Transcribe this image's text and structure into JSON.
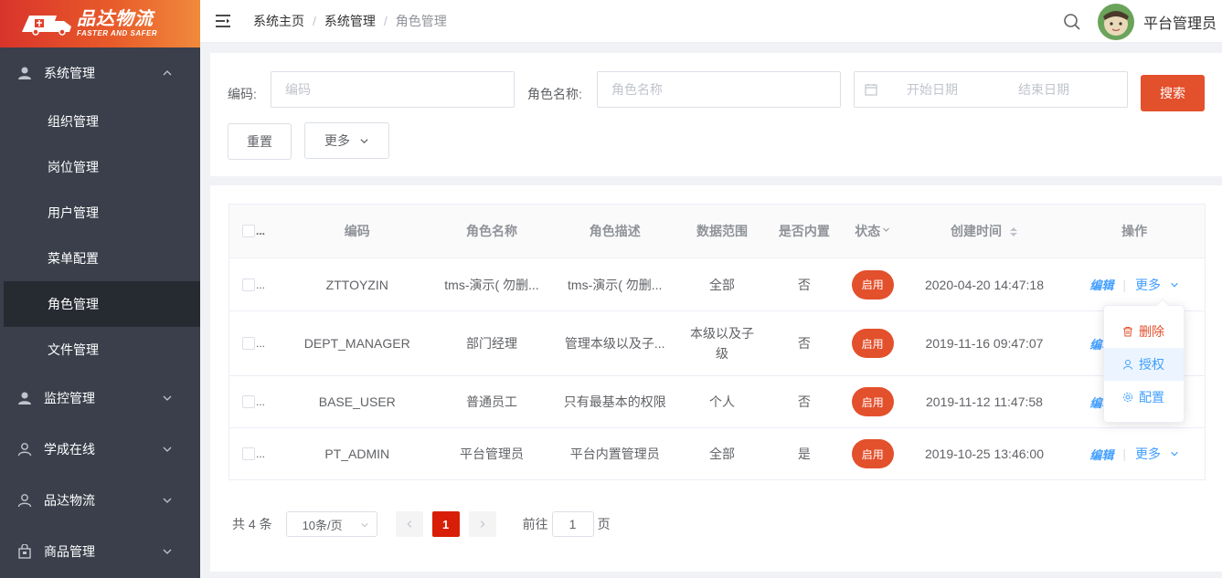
{
  "brand": {
    "name_cn": "品达物流",
    "slogan": "FASTER AND SAFER"
  },
  "sidebar": {
    "groups": [
      {
        "label": "系统管理",
        "icon": "user-icon",
        "expanded": true,
        "items": [
          {
            "label": "组织管理",
            "active": false
          },
          {
            "label": "岗位管理",
            "active": false
          },
          {
            "label": "用户管理",
            "active": false
          },
          {
            "label": "菜单配置",
            "active": false
          },
          {
            "label": "角色管理",
            "active": true
          },
          {
            "label": "文件管理",
            "active": false
          }
        ]
      },
      {
        "label": "监控管理",
        "icon": "user-icon",
        "expanded": false
      },
      {
        "label": "学成在线",
        "icon": "user-outline-icon",
        "expanded": false
      },
      {
        "label": "品达物流",
        "icon": "user-outline-icon",
        "expanded": false
      },
      {
        "label": "商品管理",
        "icon": "bag-icon",
        "expanded": false
      }
    ]
  },
  "header": {
    "breadcrumb": [
      "系统主页",
      "系统管理",
      "角色管理"
    ],
    "separator": "/",
    "username": "平台管理员"
  },
  "search": {
    "code_label": "编码:",
    "code_placeholder": "编码",
    "name_label": "角色名称:",
    "name_placeholder": "角色名称",
    "start_placeholder": "开始日期",
    "end_placeholder": "结束日期",
    "search_button": "搜索",
    "reset_button": "重置",
    "more_button": "更多"
  },
  "table": {
    "columns": [
      "编码",
      "角色名称",
      "角色描述",
      "数据范围",
      "是否内置",
      "状态",
      "创建时间",
      "操作"
    ],
    "rows": [
      {
        "code": "ZTTOYZIN",
        "name": "tms-演示( 勿删...",
        "desc": "tms-演示( 勿删...",
        "scope": "全部",
        "builtin": "否",
        "status": "启用",
        "created": "2020-04-20 14:47:18"
      },
      {
        "code": "DEPT_MANAGER",
        "name": "部门经理",
        "desc": "管理本级以及子...",
        "scope": "本级以及子级",
        "builtin": "否",
        "status": "启用",
        "created": "2019-11-16 09:47:07"
      },
      {
        "code": "BASE_USER",
        "name": "普通员工",
        "desc": "只有最基本的权限",
        "scope": "个人",
        "builtin": "否",
        "status": "启用",
        "created": "2019-11-12 11:47:58"
      },
      {
        "code": "PT_ADMIN",
        "name": "平台管理员",
        "desc": "平台内置管理员",
        "scope": "全部",
        "builtin": "是",
        "status": "启用",
        "created": "2019-10-25 13:46:00"
      }
    ],
    "edit_label": "编辑",
    "more_label": "更多"
  },
  "dropdown": {
    "items": [
      {
        "label": "删除",
        "icon": "trash-icon"
      },
      {
        "label": "授权",
        "icon": "user-icon"
      },
      {
        "label": "配置",
        "icon": "gear-icon"
      }
    ]
  },
  "pagination": {
    "total": "共 4 条",
    "page_size": "10条/页",
    "current_page": "1",
    "goto_prefix": "前往",
    "goto_value": "1",
    "goto_suffix": "页"
  },
  "colors": {
    "accent": "#e3502c",
    "link": "#409eff",
    "sidebar_bg": "#3a3f4b",
    "page_active": "#d81e06"
  }
}
